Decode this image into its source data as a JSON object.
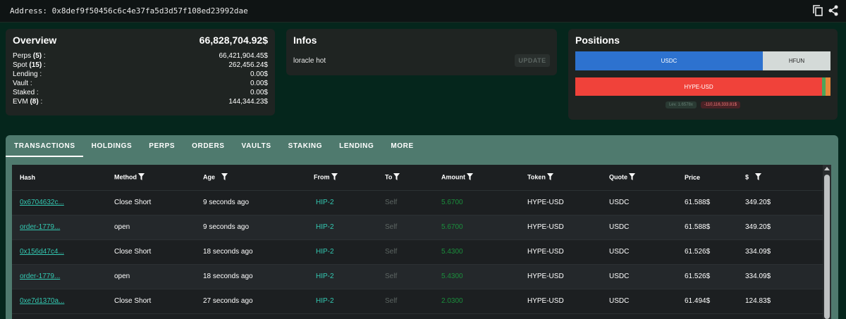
{
  "address": {
    "label": "Address: 0x8def9f50456c6c4e37fa5d3d57f108ed23992dae"
  },
  "overview": {
    "title": "Overview",
    "total": "66,828,704.92$",
    "rows": [
      {
        "label": "Perps ",
        "count": "(5)",
        "suffix": " :",
        "value": "66,421,904.45$"
      },
      {
        "label": "Spot ",
        "count": "(15)",
        "suffix": " :",
        "value": "262,456.24$"
      },
      {
        "label": "Lending :",
        "count": "",
        "suffix": "",
        "value": "0.00$"
      },
      {
        "label": "Vault :",
        "count": "",
        "suffix": "",
        "value": "0.00$"
      },
      {
        "label": "Staked :",
        "count": "",
        "suffix": "",
        "value": "0.00$"
      },
      {
        "label": "EVM ",
        "count": "(8)",
        "suffix": " :",
        "value": "144,344.23$"
      }
    ]
  },
  "infos": {
    "title": "Infos",
    "label": "loracle hot",
    "update_label": "UPDATE"
  },
  "positions": {
    "title": "Positions",
    "spot_bar": [
      {
        "label": "USDC",
        "share": 0.735
      },
      {
        "label": "HFUN",
        "share": 0.265
      }
    ],
    "perp_bar": [
      {
        "label": "HYPE-USD",
        "share": 0.967
      }
    ],
    "lev_badge": "Lev. 1.6578x",
    "pnl_badge": "-110,116,333.81$"
  },
  "tabs": [
    "TRANSACTIONS",
    "HOLDINGS",
    "PERPS",
    "ORDERS",
    "VAULTS",
    "STAKING",
    "LENDING",
    "MORE"
  ],
  "table": {
    "headers": [
      "Hash",
      "Method",
      "Age",
      "From",
      "To",
      "Amount",
      "Token",
      "Quote",
      "Price",
      "$"
    ],
    "rows": [
      [
        "0x6704632c...",
        "Close Short",
        "9 seconds ago",
        "HIP-2",
        "Self",
        "5.6700",
        "HYPE-USD",
        "USDC",
        "61.588$",
        "349.20$"
      ],
      [
        "order-1779...",
        "open",
        "9 seconds ago",
        "HIP-2",
        "Self",
        "5.6700",
        "HYPE-USD",
        "USDC",
        "61.588$",
        "349.20$"
      ],
      [
        "0x156d47c4...",
        "Close Short",
        "18 seconds ago",
        "HIP-2",
        "Self",
        "5.4300",
        "HYPE-USD",
        "USDC",
        "61.526$",
        "334.09$"
      ],
      [
        "order-1779...",
        "open",
        "18 seconds ago",
        "HIP-2",
        "Self",
        "5.4300",
        "HYPE-USD",
        "USDC",
        "61.526$",
        "334.09$"
      ],
      [
        "0xe7d1370a...",
        "Close Short",
        "27 seconds ago",
        "HIP-2",
        "Self",
        "2.0300",
        "HYPE-USD",
        "USDC",
        "61.494$",
        "124.83$"
      ]
    ]
  },
  "colors": {
    "background": "#05261c",
    "card": "#1f2422",
    "tab_bar": "#4f7a6e",
    "accent_teal": "#33c9b2",
    "usdc": "#2d72cf",
    "hype": "#f0423a"
  },
  "icons": [
    "copy-icon",
    "share-icon",
    "filter-icon"
  ]
}
